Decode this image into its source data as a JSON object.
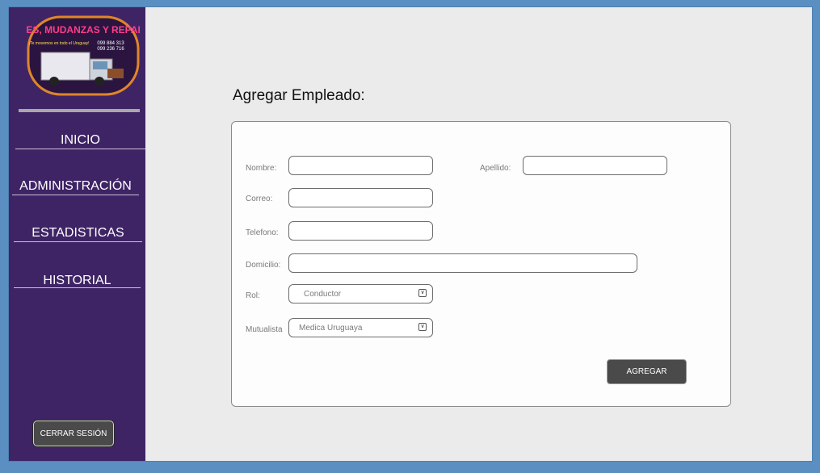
{
  "sidebar": {
    "logo": {
      "line1": "FLETES, MUDANZAS Y REPARTOS",
      "tagline": "¡Te movemos en todo el Uruguay!",
      "phone1": "099 884 313",
      "phone2": "099 236 716"
    },
    "nav": [
      {
        "label": "INICIO"
      },
      {
        "label": "ADMINISTRACIÓN"
      },
      {
        "label": "ESTADISTICAS"
      },
      {
        "label": "HISTORIAL"
      }
    ],
    "logout_label": "CERRAR SESIÓN"
  },
  "main": {
    "title": "Agregar Empleado:",
    "form": {
      "nombre_label": "Nombre:",
      "apellido_label": "Apellido:",
      "correo_label": "Correo:",
      "telefono_label": "Telefono:",
      "domicilio_label": "Domicilio:",
      "rol_label": "Rol:",
      "rol_value": "Conductor",
      "mutualista_label": "Mutualista",
      "mutualista_value": "Medica Uruguaya",
      "submit_label": "AGREGAR"
    }
  },
  "colors": {
    "sidebar": "#3f2465",
    "background": "#ebebeb",
    "frame_border": "#5b8fc2",
    "button": "#4a4a4a"
  },
  "icons": {
    "select_arrow": "dropdown-arrow-icon"
  }
}
